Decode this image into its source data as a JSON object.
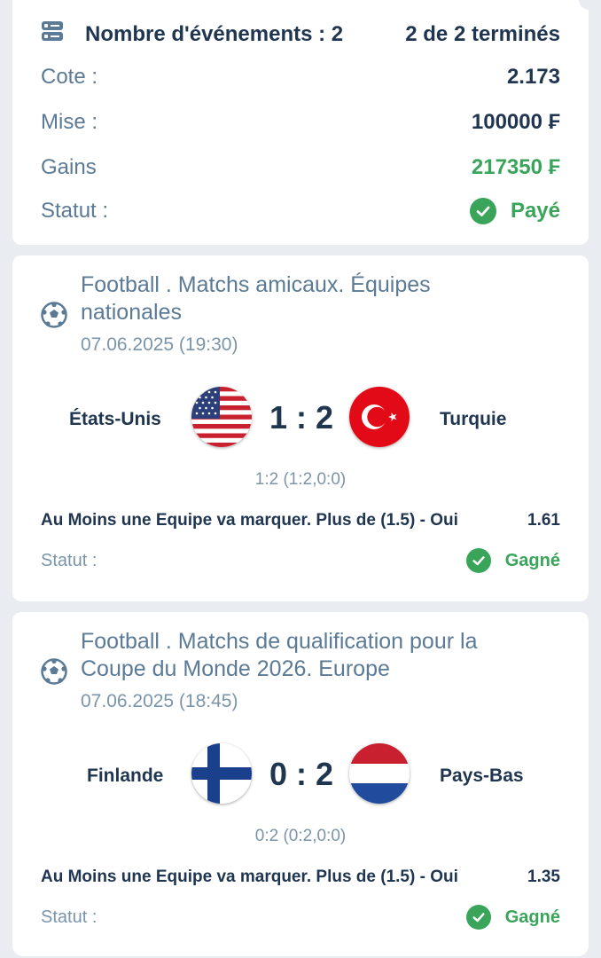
{
  "summary": {
    "events_label": "Nombre d'événements : 2",
    "events_done": "2 de 2 terminés",
    "odds_label": "Cote :",
    "odds_value": "2.173",
    "stake_label": "Mise :",
    "stake_value": "100000 ₣",
    "winnings_label": "Gains",
    "winnings_value": "217350 ₣",
    "status_label": "Statut :",
    "status_value": "Payé"
  },
  "events": [
    {
      "title": "Football . Matchs amicaux. Équipes nationales",
      "date": "07.06.2025 (19:30)",
      "home": "États-Unis",
      "away": "Turquie",
      "score": "1 : 2",
      "subscore": "1:2 (1:2,0:0)",
      "bet": "Au Moins une Equipe va marquer. Plus de (1.5) - Oui",
      "odds": "1.61",
      "status_label": "Statut :",
      "status_value": "Gagné"
    },
    {
      "title": "Football . Matchs de qualification pour la Coupe du Monde 2026. Europe",
      "date": "07.06.2025 (18:45)",
      "home": "Finlande",
      "away": "Pays-Bas",
      "score": "0 : 2",
      "subscore": "0:2 (0:2,0:0)",
      "bet": "Au Moins une Equipe va marquer. Plus de (1.5) - Oui",
      "odds": "1.35",
      "status_label": "Statut :",
      "status_value": "Gagné"
    }
  ],
  "colors": {
    "accent_green": "#3aa55a",
    "text_dark": "#1f3550",
    "text_muted": "#5a7a96",
    "background": "#e9edf2"
  },
  "icons": {
    "events": "list-toggle-icon",
    "sport": "soccer-ball-icon",
    "status": "check-circle-icon"
  }
}
